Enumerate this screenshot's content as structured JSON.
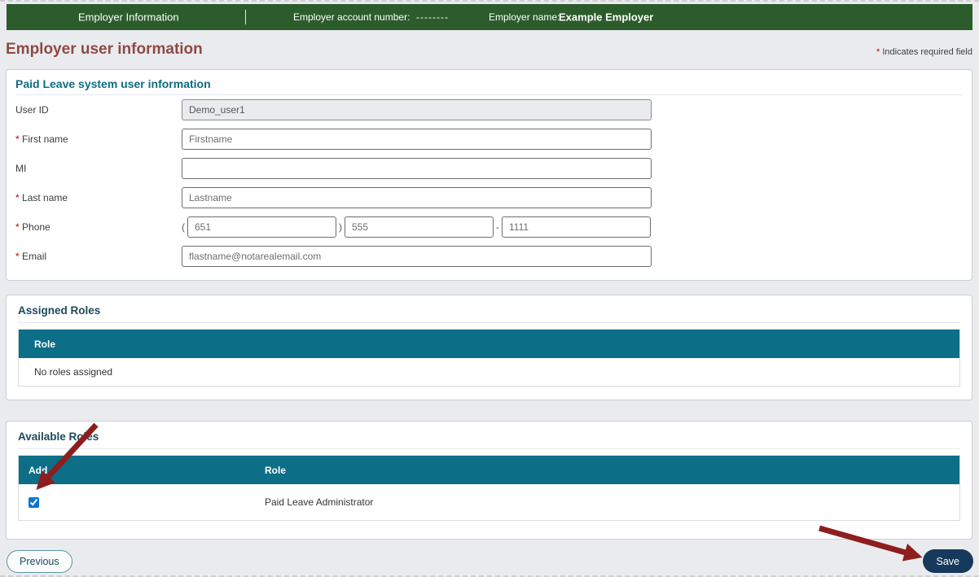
{
  "header": {
    "nav_title": "Employer Information",
    "account_label": "Employer account number:",
    "account_value": "--------",
    "employer_label": "Employer name:",
    "employer_value": "Example Employer"
  },
  "page": {
    "title": "Employer user information",
    "required_marker": "*",
    "required_note": "Indicates required field"
  },
  "user_info": {
    "section_title": "Paid Leave system user information",
    "fields": {
      "user_id": {
        "label": "User ID",
        "value": "Demo_user1"
      },
      "first_name": {
        "label": "First name",
        "value": "Firstname"
      },
      "mi": {
        "label": "MI",
        "value": ""
      },
      "last_name": {
        "label": "Last name",
        "value": "Lastname"
      },
      "phone": {
        "label": "Phone",
        "open_paren": "(",
        "area": "651",
        "close_paren": ")",
        "prefix": "555",
        "dash": "-",
        "line": "1111"
      },
      "email": {
        "label": "Email",
        "value": "flastname@notarealemail.com"
      }
    }
  },
  "assigned_roles": {
    "section_title": "Assigned Roles",
    "columns": [
      "Role"
    ],
    "empty_text": "No roles assigned"
  },
  "available_roles": {
    "section_title": "Available Roles",
    "columns": [
      "Add",
      "Role"
    ],
    "rows": [
      {
        "checked": "checked",
        "role": "Paid Leave Administrator"
      }
    ]
  },
  "footer": {
    "previous_label": "Previous",
    "save_label": "Save"
  },
  "colors": {
    "header_green": "#2c5c2c",
    "table_header_teal": "#0d6e87",
    "section_teal": "#0f6b80",
    "section_navy": "#1d4a5a",
    "title_maroon": "#8e4a42",
    "required_red": "#c00000",
    "save_navy": "#17395c",
    "annotation_arrow": "#8e1e1e",
    "checkbox_blue": "#0b76d1"
  }
}
